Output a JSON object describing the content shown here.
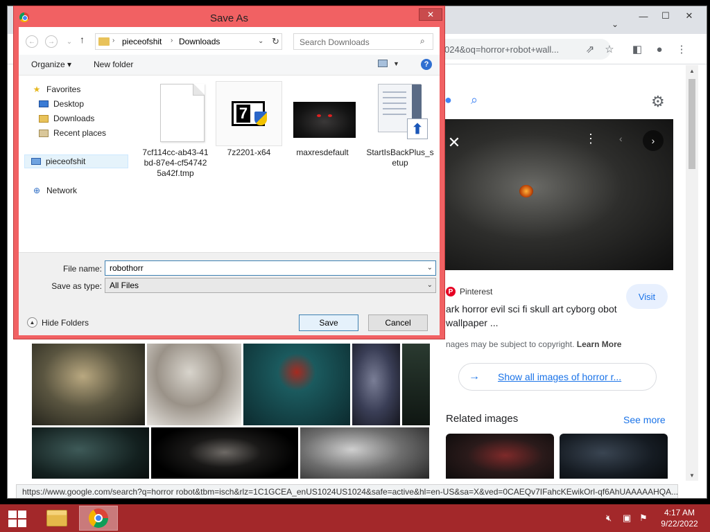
{
  "browser": {
    "omnibox_text": "024&oq=horror+robot+wall...",
    "status_url": "https://www.google.com/search?q=horror robot&tbm=isch&rlz=1C1GCEA_enUS1024US1024&safe=active&hl=en-US&sa=X&ved=0CAEQv7IFahcKEwikOrl-qf6AhUAAAAAHQA..."
  },
  "side_panel": {
    "source": "Pinterest",
    "visit_label": "Visit",
    "title": "ark horror evil sci fi skull art cyborg obot wallpaper ...",
    "copyright": "nages may be subject to copyright.",
    "learn_more": "Learn More",
    "show_all": "Show all images of horror r...",
    "related_heading": "Related images",
    "see_more": "See more"
  },
  "dialog": {
    "title": "Save As",
    "breadcrumb": [
      "pieceofshit",
      "Downloads"
    ],
    "search_placeholder": "Search Downloads",
    "commands": {
      "organize": "Organize",
      "new_folder": "New folder"
    },
    "nav": {
      "favorites": "Favorites",
      "desktop": "Desktop",
      "downloads": "Downloads",
      "recent": "Recent places",
      "user": "pieceofshit",
      "network": "Network"
    },
    "files": [
      {
        "name": "7cf114cc-ab43-41bd-87e4-cf547425a42f.tmp",
        "kind": "blank-file"
      },
      {
        "name": "7z2201-x64",
        "kind": "7zip-installer"
      },
      {
        "name": "maxresdefault",
        "kind": "image"
      },
      {
        "name": "StartIsBackPlus_setup",
        "kind": "installer"
      }
    ],
    "file_name_label": "File name:",
    "file_name_value": "robothorr",
    "save_type_label": "Save as type:",
    "save_type_value": "All Files",
    "hide_folders": "Hide Folders",
    "save_label": "Save",
    "cancel_label": "Cancel"
  },
  "taskbar": {
    "time": "4:17 AM",
    "date": "9/22/2022"
  },
  "colors": {
    "dialog_frame": "#f16163",
    "taskbar": "#a3282a",
    "link": "#1a73e8"
  }
}
